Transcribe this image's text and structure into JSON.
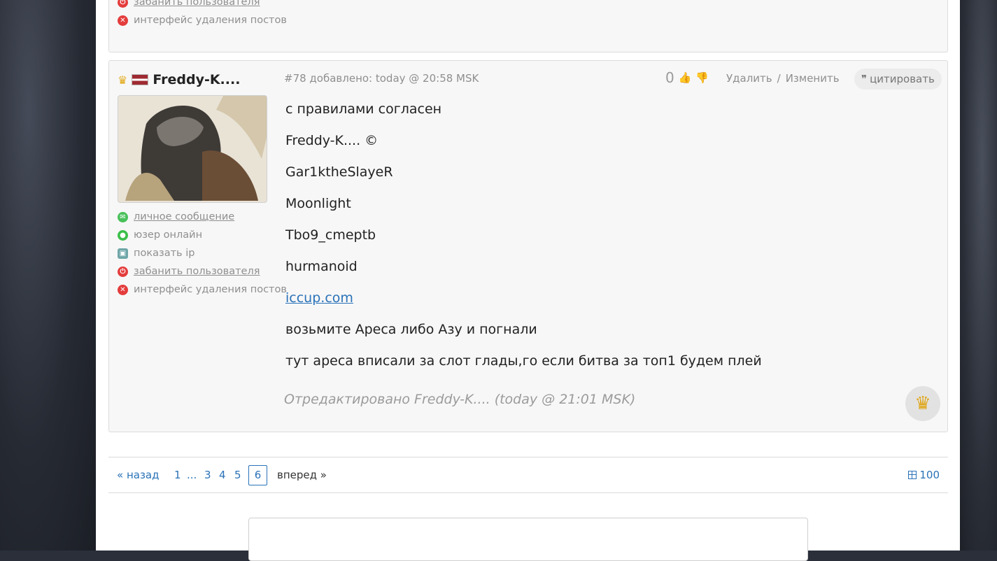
{
  "prev_post": {
    "links": [
      {
        "icon": "power-icon",
        "label": "забанить пользователя"
      },
      {
        "icon": "x-circle-icon",
        "label": "интерфейс удаления постов"
      }
    ]
  },
  "post": {
    "username": "Freddy-K....",
    "meta": "#78 добавлено: today @ 20:58 MSK",
    "score": "0",
    "delete_label": "Удалить",
    "edit_label": "Изменить",
    "separator": "/",
    "quote_label": "цитировать",
    "links": [
      {
        "label": "личное сообщение"
      },
      {
        "label": "юзер онлайн"
      },
      {
        "label": "показать ip"
      },
      {
        "label": "забанить пользователя"
      },
      {
        "label": "интерфейс удаления постов"
      }
    ],
    "lines": [
      "с правилами согласен",
      "Freddy-K.... ©",
      "Gar1ktheSlayeR",
      "Moonlight",
      "Tbo9_cmeptb",
      "hurmanoid",
      "iccup.com",
      "возьмите Ареса либо Азу и погнали",
      "тут ареса вписали за слот глады,го если битва за топ1 будем плей"
    ],
    "edited": "Отредактировано Freddy-K.... (today @ 21:01 MSK)"
  },
  "pagination": {
    "prev": "« назад",
    "pages": [
      "1",
      "...",
      "3",
      "4",
      "5"
    ],
    "current": "6",
    "next": "вперед »",
    "per_page": "100"
  },
  "colors": {
    "link": "#2a72b8",
    "accent_red": "#e43c3c",
    "online_green": "#3cbf4a"
  }
}
